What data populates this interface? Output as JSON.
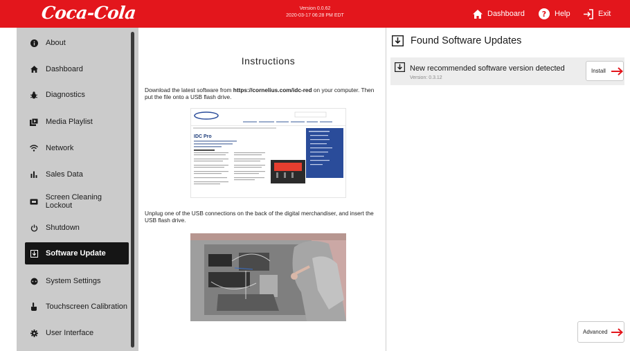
{
  "header": {
    "logo_text": "Coca-Cola",
    "version_label": "Version 0.0.62",
    "timestamp": "2020-03-17 06:28 PM EDT",
    "nav": {
      "dashboard": "Dashboard",
      "help": "Help",
      "exit": "Exit"
    }
  },
  "sidebar": {
    "items": [
      {
        "label": "About",
        "icon": "info-icon"
      },
      {
        "label": "Dashboard",
        "icon": "home-icon"
      },
      {
        "label": "Diagnostics",
        "icon": "bug-icon"
      },
      {
        "label": "Media Playlist",
        "icon": "media-icon"
      },
      {
        "label": "Network",
        "icon": "wifi-icon"
      },
      {
        "label": "Sales Data",
        "icon": "bar-chart-icon"
      },
      {
        "label": "Screen Cleaning Lockout",
        "icon": "screen-lock-icon"
      },
      {
        "label": "Shutdown",
        "icon": "power-icon"
      },
      {
        "label": "Software Update",
        "icon": "download-icon",
        "active": true
      },
      {
        "label": "System Settings",
        "icon": "settings-icon"
      },
      {
        "label": "Touchscreen Calibration",
        "icon": "touch-icon"
      },
      {
        "label": "User Interface",
        "icon": "gear-icon"
      }
    ]
  },
  "instructions": {
    "title": "Instructions",
    "p1_before": "Download the latest software from ",
    "p1_link": "https://cornelius.com/idc-red",
    "p1_after": " on your computer. Then put the file onto a USB flash drive.",
    "p2": "Unplug one of the USB connections on the back of the digital merchandiser, and insert the USB flash drive.",
    "screenshot_heading": "IDC Pro"
  },
  "updates": {
    "title": "Found Software Updates",
    "item_text": "New recommended software version detected",
    "item_version": "Version: 0.3.12",
    "install_label": "Install",
    "advanced_label": "Advanced"
  },
  "colors": {
    "brand_red": "#e3161c",
    "sidebar_bg": "#cbcbcb",
    "active_bg": "#151515"
  }
}
